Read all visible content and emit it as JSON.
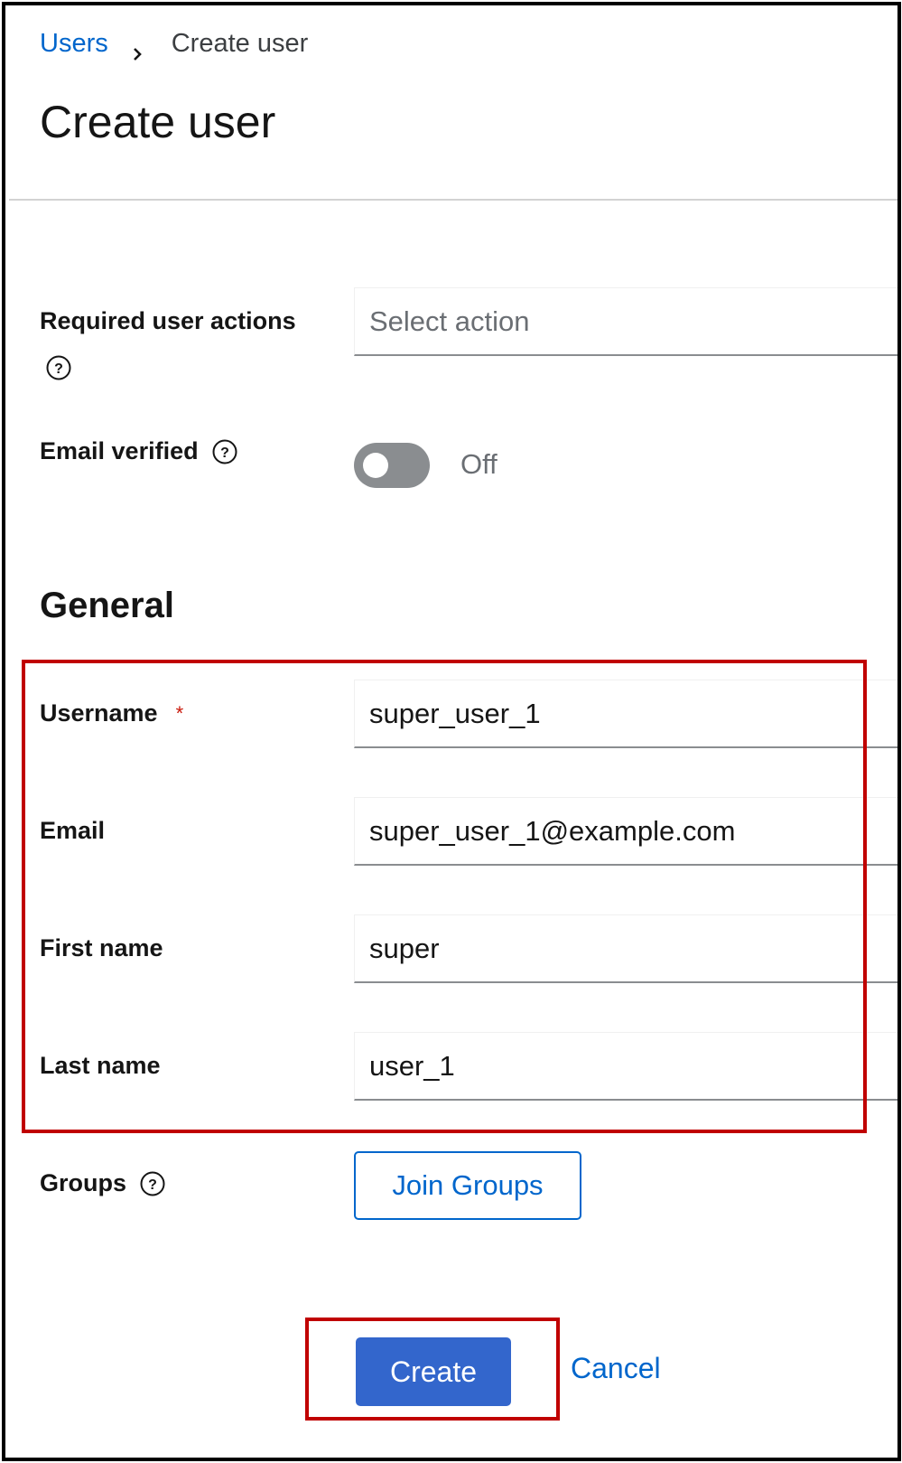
{
  "breadcrumb": {
    "parent": "Users",
    "current": "Create user"
  },
  "page_title": "Create user",
  "form": {
    "required_actions": {
      "label": "Required user actions",
      "placeholder": "Select action"
    },
    "email_verified": {
      "label": "Email verified",
      "state_text": "Off",
      "enabled": false
    },
    "general_title": "General",
    "username": {
      "label": "Username",
      "required_marker": "*",
      "value": "super_user_1"
    },
    "email": {
      "label": "Email",
      "value": "super_user_1@example.com"
    },
    "first_name": {
      "label": "First name",
      "value": "super"
    },
    "last_name": {
      "label": "Last name",
      "value": "user_1"
    },
    "groups": {
      "label": "Groups",
      "button_label": "Join Groups"
    }
  },
  "actions": {
    "create_label": "Create",
    "cancel_label": "Cancel"
  },
  "icons": {
    "help": "help-circle-icon",
    "breadcrumb_separator": "chevron-right-icon"
  },
  "colors": {
    "link": "#0066cc",
    "primary_button": "#3366cc",
    "highlight": "#c00000",
    "required": "#c9190b"
  }
}
